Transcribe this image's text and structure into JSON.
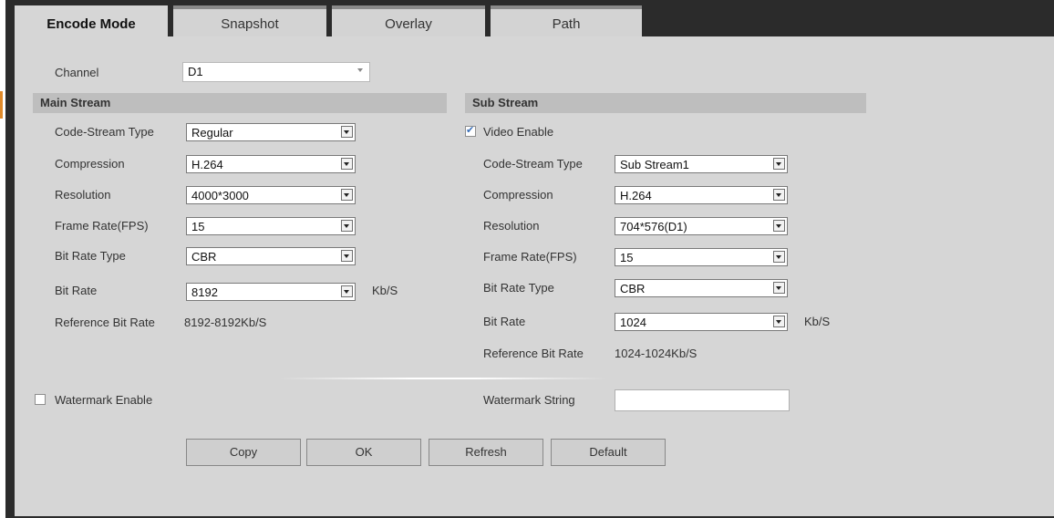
{
  "tabs": [
    {
      "label": "Encode Mode",
      "active": true
    },
    {
      "label": "Snapshot",
      "active": false
    },
    {
      "label": "Overlay",
      "active": false
    },
    {
      "label": "Path",
      "active": false
    }
  ],
  "channel": {
    "label": "Channel",
    "value": "D1"
  },
  "main_stream": {
    "title": "Main Stream",
    "code_stream_type": {
      "label": "Code-Stream Type",
      "value": "Regular"
    },
    "compression": {
      "label": "Compression",
      "value": "H.264"
    },
    "resolution": {
      "label": "Resolution",
      "value": "4000*3000"
    },
    "frame_rate": {
      "label": "Frame Rate(FPS)",
      "value": "15"
    },
    "bit_rate_type": {
      "label": "Bit Rate Type",
      "value": "CBR"
    },
    "bit_rate": {
      "label": "Bit Rate",
      "value": "8192",
      "unit": "Kb/S"
    },
    "reference_bit_rate": {
      "label": "Reference Bit Rate",
      "value": "8192-8192Kb/S"
    }
  },
  "sub_stream": {
    "title": "Sub Stream",
    "video_enable": {
      "label": "Video Enable",
      "checked": true
    },
    "code_stream_type": {
      "label": "Code-Stream Type",
      "value": "Sub Stream1"
    },
    "compression": {
      "label": "Compression",
      "value": "H.264"
    },
    "resolution": {
      "label": "Resolution",
      "value": "704*576(D1)"
    },
    "frame_rate": {
      "label": "Frame Rate(FPS)",
      "value": "15"
    },
    "bit_rate_type": {
      "label": "Bit Rate Type",
      "value": "CBR"
    },
    "bit_rate": {
      "label": "Bit Rate",
      "value": "1024",
      "unit": "Kb/S"
    },
    "reference_bit_rate": {
      "label": "Reference Bit Rate",
      "value": "1024-1024Kb/S"
    }
  },
  "watermark": {
    "enable_label": "Watermark Enable",
    "enabled": false,
    "string_label": "Watermark String",
    "string_value": ""
  },
  "buttons": {
    "copy": "Copy",
    "ok": "OK",
    "refresh": "Refresh",
    "default": "Default"
  },
  "colors": {
    "frame": "#2b2b2b",
    "panel": "#d6d6d6",
    "section_bar": "#bebebe",
    "accent": "#e08a2a",
    "checkmark": "#3a6fb8"
  }
}
